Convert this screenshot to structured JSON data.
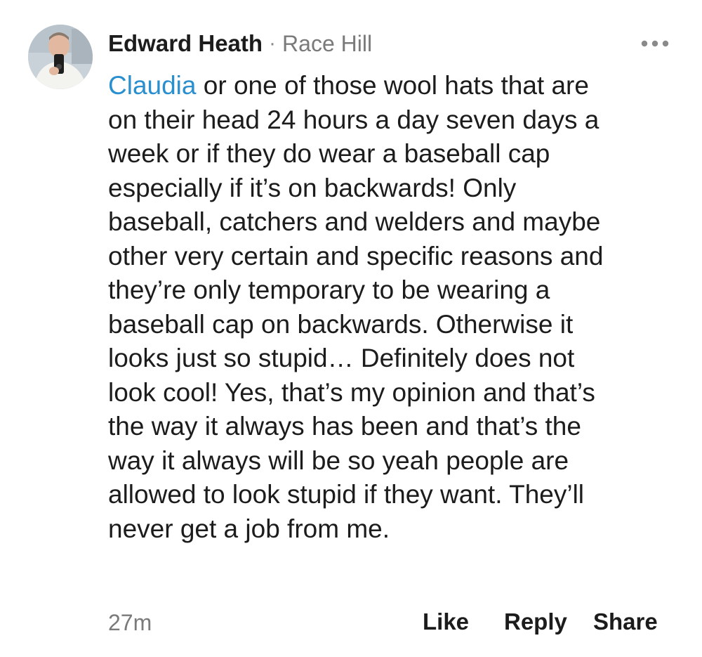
{
  "comment": {
    "author": "Edward Heath",
    "separator": "·",
    "location": "Race Hill",
    "mention": "Claudia",
    "body_lines": [
      " or one of those wool hats that are",
      "on their head 24 hours a day seven days a",
      "week or if they do wear a baseball cap",
      "especially if it’s on backwards! Only",
      "baseball, catchers and welders and maybe",
      "other very certain and specific reasons and",
      "they’re only temporary to be wearing a",
      "baseball cap on backwards. Otherwise it",
      "looks just so stupid… Definitely does not",
      "look cool! Yes, that’s my opinion and that’s",
      "the way it always has been and that’s the",
      "way it always will be so yeah people are",
      "allowed to look stupid if they want. They’ll",
      "never get a job from me."
    ],
    "timestamp": "27m",
    "actions": {
      "like": "Like",
      "reply": "Reply",
      "share": "Share"
    }
  },
  "icons": {
    "avatar": "avatar-photo",
    "more": "more-horizontal-icon"
  },
  "colors": {
    "mention": "#2a8fcf",
    "text": "#1c1c1c",
    "muted": "#7a7a7a"
  }
}
